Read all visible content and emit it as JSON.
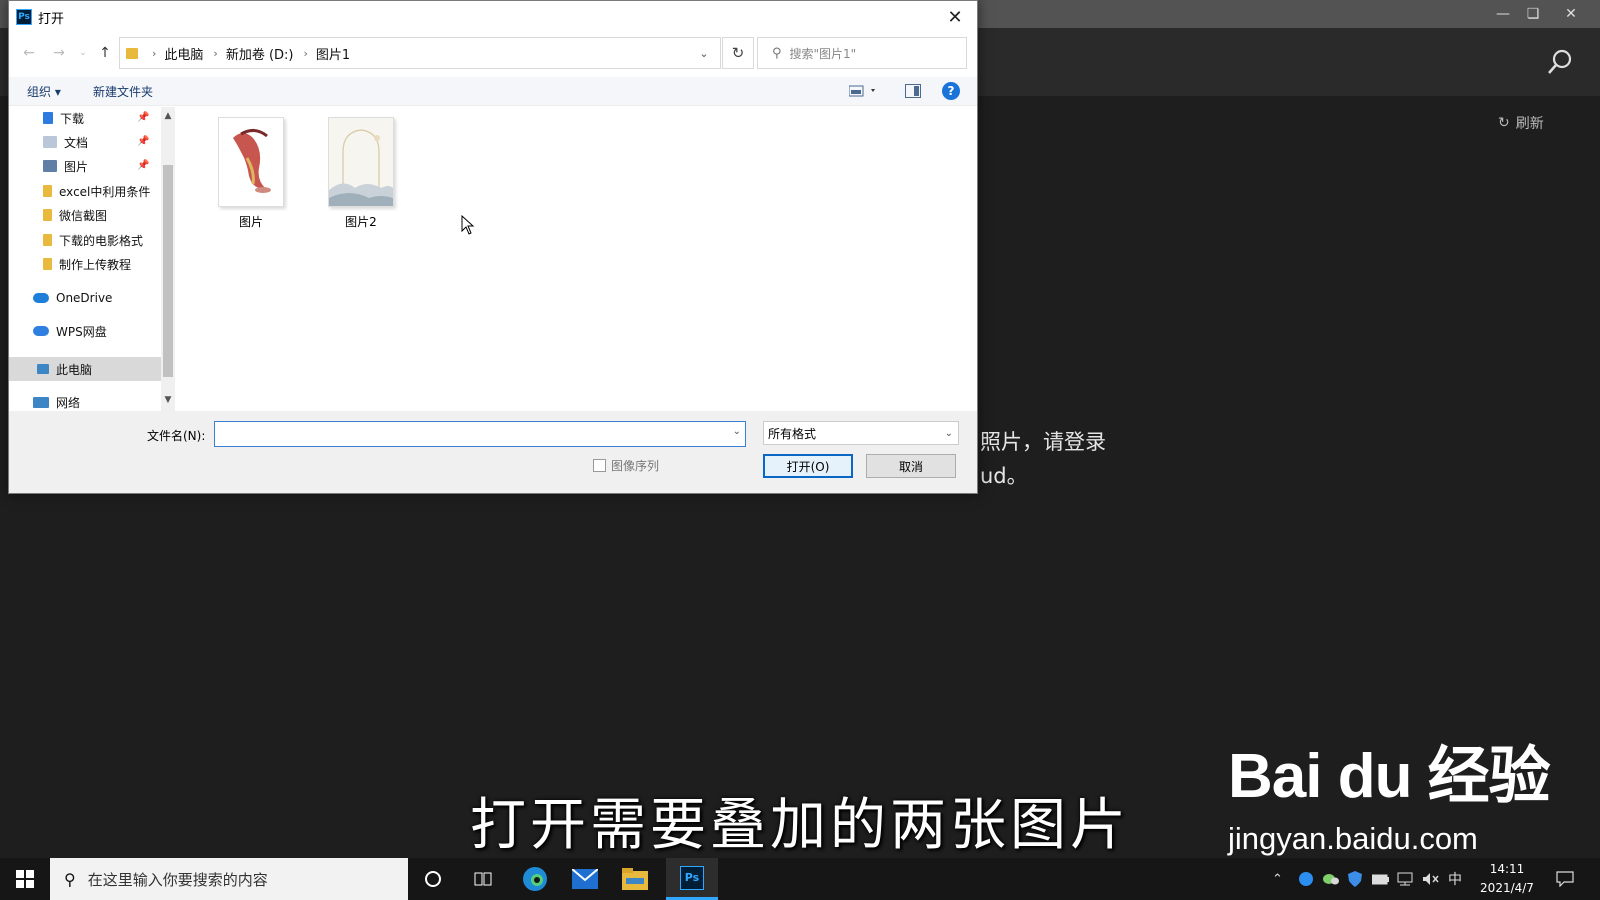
{
  "dialog": {
    "title": "打开",
    "app_logo_text": "Ps",
    "breadcrumb": [
      "此电脑",
      "新加卷 (D:)",
      "图片1"
    ],
    "search_placeholder": "搜索\"图片1\"",
    "toolbar": {
      "organize": "组织 ▾",
      "new_folder": "新建文件夹"
    },
    "nav": {
      "quick_access": [
        {
          "label": "下载",
          "pinned": true
        },
        {
          "label": "文档",
          "pinned": true
        },
        {
          "label": "图片",
          "pinned": true
        },
        {
          "label": "excel中利用条件",
          "pinned": false
        },
        {
          "label": "微信截图",
          "pinned": false
        },
        {
          "label": "下载的电影格式",
          "pinned": false
        },
        {
          "label": "制作上传教程",
          "pinned": false
        }
      ],
      "onedrive": "OneDrive",
      "wps": "WPS网盘",
      "this_pc": "此电脑",
      "network": "网络"
    },
    "files": [
      {
        "name": "图片"
      },
      {
        "name": "图片2"
      }
    ],
    "filename_label": "文件名(N):",
    "filename_value": "",
    "filter_value": "所有格式",
    "image_sequence_label": "图像序列",
    "open_button": "打开(O)",
    "cancel_button": "取消"
  },
  "background": {
    "refresh_label": "刷新",
    "message_lines": [
      "照片，请登录",
      "ud。"
    ]
  },
  "overlay": {
    "subtitle": "打开需要叠加的两张图片",
    "watermark_brand": "Bai du 经验",
    "watermark_url": "jingyan.baidu.com"
  },
  "taskbar": {
    "search_placeholder": "在这里输入你要搜索的内容",
    "ime": "中",
    "time": "14:11",
    "date": "2021/4/7"
  },
  "colors": {
    "accent": "#0b67c6",
    "ps_blue": "#31a8ff",
    "dark_bg": "#1e1e1e"
  }
}
